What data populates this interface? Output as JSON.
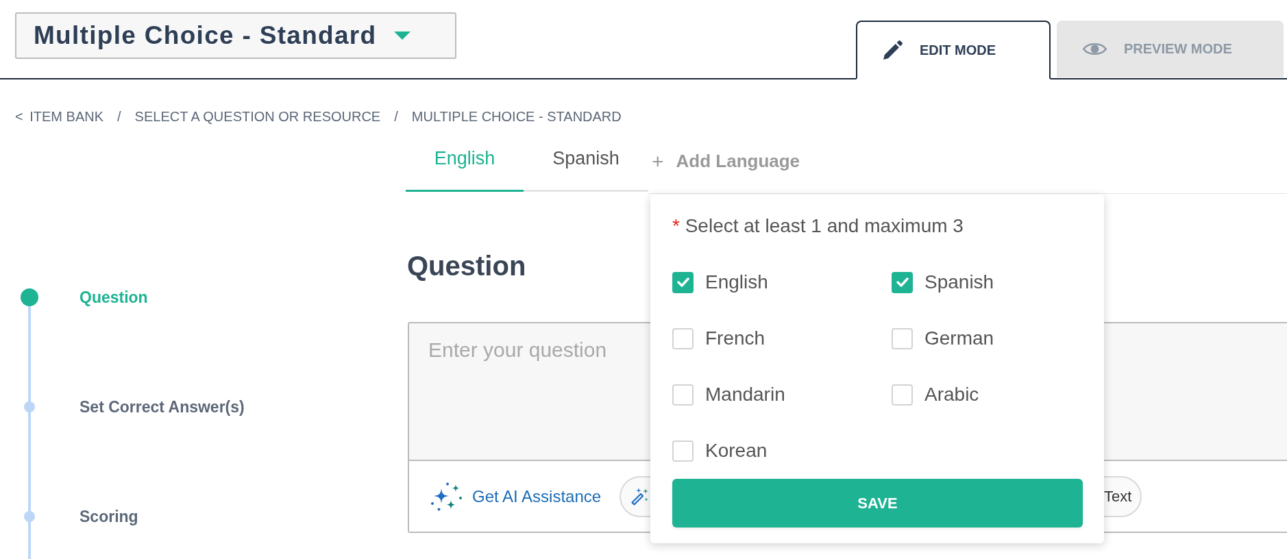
{
  "question_type_selector": {
    "label": "Multiple Choice - Standard"
  },
  "mode_tabs": [
    {
      "kind": "edit",
      "label": "EDIT MODE",
      "selected": true
    },
    {
      "kind": "preview",
      "label": "PREVIEW MODE",
      "selected": false
    }
  ],
  "breadcrumb": [
    {
      "back_symbol": "<",
      "label": "ITEM BANK"
    },
    {
      "separator": "/",
      "label": "SELECT A QUESTION OR RESOURCE"
    },
    {
      "separator": "/",
      "label": "MULTIPLE CHOICE - STANDARD"
    }
  ],
  "language_tabs": [
    {
      "label": "English",
      "selected": true
    },
    {
      "label": "Spanish",
      "selected": false
    }
  ],
  "add_language": {
    "symbol": "+",
    "label": "Add Language"
  },
  "steps": [
    {
      "label": "Question",
      "selected": true
    },
    {
      "label": "Set Correct Answer(s)",
      "selected": false
    },
    {
      "label": "Scoring",
      "selected": false
    }
  ],
  "question_section": {
    "heading": "Question",
    "editor": {
      "placeholder": "Enter your question"
    },
    "ai_assistance": {
      "label": "Get AI Assistance"
    },
    "text_button": {
      "label": "Text"
    }
  },
  "language_popup": {
    "required_mark": "*",
    "instruction": "Select at least 1 and maximum 3",
    "options": [
      {
        "label": "English",
        "checked": true
      },
      {
        "label": "Spanish",
        "checked": true
      },
      {
        "label": "French",
        "checked": false
      },
      {
        "label": "German",
        "checked": false
      },
      {
        "label": "Mandarin",
        "checked": false
      },
      {
        "label": "Arabic",
        "checked": false
      },
      {
        "label": "Korean",
        "checked": false
      }
    ],
    "save_button": {
      "label": "SAVE"
    }
  }
}
